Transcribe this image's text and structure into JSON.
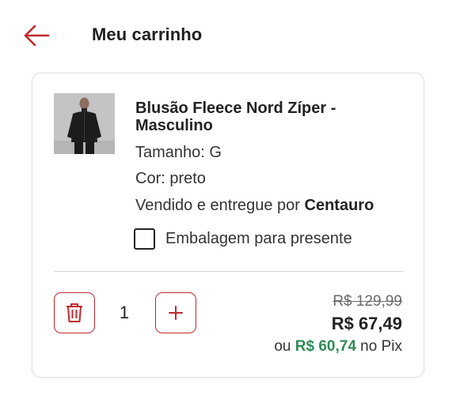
{
  "header": {
    "title": "Meu carrinho",
    "back_icon": "arrow-left-icon",
    "accent_color": "#c0282e"
  },
  "cart_item": {
    "image_alt": "product-thumbnail",
    "name": "Blusão Fleece Nord Zíper - Masculino",
    "size": "Tamanho: G",
    "color": "Cor: preto",
    "seller_prefix": "Vendido e entregue por ",
    "seller_name": "Centauro",
    "gift_wrap_label": "Embalagem para presente",
    "gift_wrap_checked": false,
    "remove_icon": "trash-icon",
    "add_icon": "plus-icon",
    "quantity": "1",
    "price_original": "R$ 129,99",
    "price_current": "R$ 67,49",
    "pix_prefix": "ou ",
    "pix_price": "R$ 60,74",
    "pix_suffix": " no Pix",
    "pix_color": "#2e8b57"
  }
}
